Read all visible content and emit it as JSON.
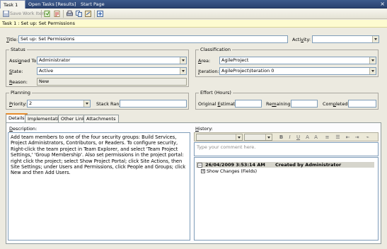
{
  "doc_tabs": [
    "Task 1",
    "Open Tasks [Results]",
    "Start Page"
  ],
  "toolbar": {
    "save_label": "Save Work Item"
  },
  "work_item_header": "Task 1 : Set up: Set Permissions",
  "fields": {
    "title_label": "Title:",
    "title_value": "Set up: Set Permissions",
    "activity_label": "Activity:",
    "activity_value": ""
  },
  "status": {
    "group_title": "Status",
    "assigned_label": "Assigned To:",
    "assigned_value": "Administrator",
    "state_label": "State:",
    "state_value": "Active",
    "reason_label": "Reason:",
    "reason_value": "New"
  },
  "classification": {
    "group_title": "Classification",
    "area_label": "Area:",
    "area_value": "AgileProject",
    "iteration_label": "Iteration:",
    "iteration_value": "AgileProject\\Iteration 0"
  },
  "planning": {
    "group_title": "Planning",
    "priority_label": "Priority:",
    "priority_value": "2",
    "stackrank_label": "Stack Rank:",
    "stackrank_value": ""
  },
  "effort": {
    "group_title": "Effort (Hours)",
    "original_label": "Original Estimate:",
    "remaining_label": "Remaining:",
    "completed_label": "Completed:"
  },
  "tabs": [
    "Details",
    "Implementation",
    "Other Links",
    "Attachments"
  ],
  "details": {
    "description_label": "Description:",
    "description_text": "Add team members to one of the four security groups: Build Services, Project Administrators, Contributors, or Readers. To configure security, Right-click the team project in Team Explorer, and select 'Team Project Settings,' 'Group Membership'. Also set permissions in the project portal: right click the project; select Show Project Portal; click Site Actions, then Site Settings; under Users and Permissions, click People and Groups; click New and then Add Users.",
    "history_label": "History:",
    "history_placeholder": "Type your comment here.",
    "history_entry_date": "26/04/2009 3:53:14 AM",
    "history_entry_author": "Created by Administrator",
    "show_changes": "Show Changes (Fields)"
  }
}
